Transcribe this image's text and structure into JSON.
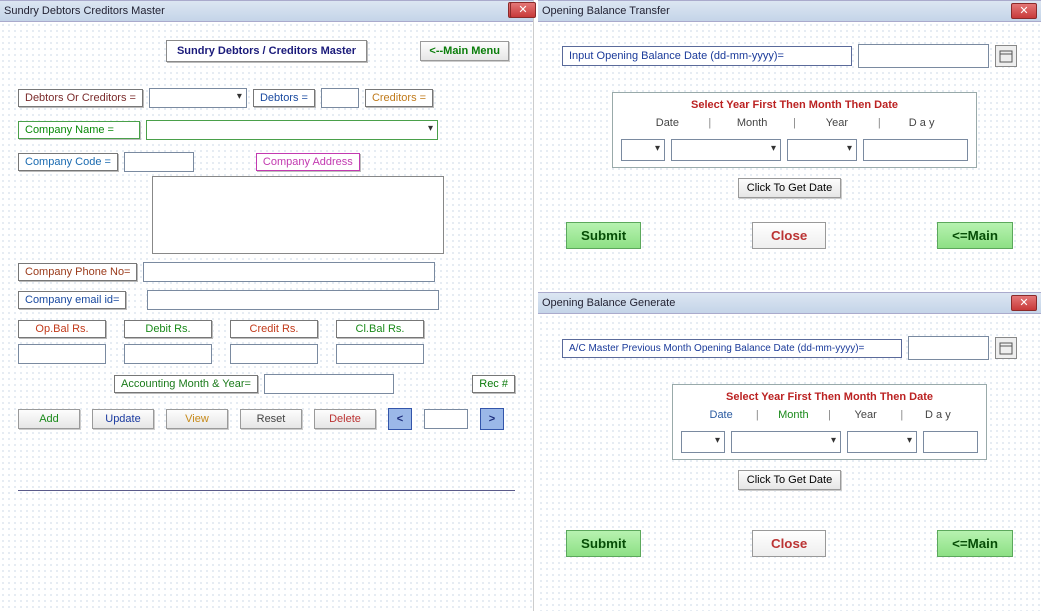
{
  "left": {
    "title": "Sundry Debtors Creditors  Master",
    "header": "Sundry Debtors / Creditors Master",
    "main_menu": "<--Main Menu",
    "debtors_or_creditors": "Debtors Or Creditors =",
    "debtors_eq": "Debtors =",
    "creditors_eq": "Creditors =",
    "company_name": "Company Name  =",
    "company_code": "Company Code   =",
    "company_address": "Company Address",
    "company_phone": "Company Phone No=",
    "company_email": "Company email id=",
    "opbal": "Op.Bal Rs.",
    "debit": "Debit Rs.",
    "credit": "Credit Rs.",
    "clbal": "Cl.Bal Rs.",
    "acct_month_year": "Accounting Month & Year=",
    "rec_num": "Rec #",
    "add": "Add",
    "update": "Update",
    "view": "View",
    "reset": "Reset",
    "delete": "Delete",
    "prev": "<",
    "next": ">"
  },
  "transfer": {
    "title": "Opening Balance Transfer",
    "input_label": "Input Opening Balance Date (dd-mm-yyyy)=",
    "picker_title": "Select Year First Then Month Then Date",
    "date": "Date",
    "month": "Month",
    "year": "Year",
    "day": "D a y",
    "click_get": "Click To Get Date",
    "submit": "Submit",
    "close": "Close",
    "main": "<=Main"
  },
  "generate": {
    "title": "Opening Balance Generate",
    "input_label": "A/C Master Previous Month Opening Balance Date (dd-mm-yyyy)=",
    "picker_title": "Select Year First Then Month Then Date",
    "date": "Date",
    "month": "Month",
    "year": "Year",
    "day": "D a y",
    "click_get": "Click To Get Date",
    "submit": "Submit",
    "close": "Close",
    "main": "<=Main"
  }
}
